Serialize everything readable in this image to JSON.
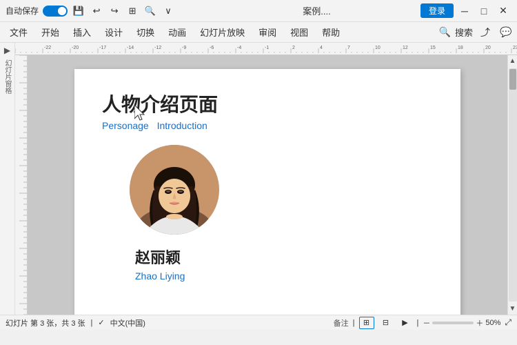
{
  "titlebar": {
    "autosave_label": "自动保存",
    "toggle_state": "on",
    "title": "案例....",
    "login_label": "登录",
    "undo_icon": "↩",
    "redo_icon": "↪",
    "save_icon": "💾",
    "min_icon": "─",
    "max_icon": "□",
    "close_icon": "✕"
  },
  "toolbar": {
    "icons": [
      "💾",
      "↩",
      "↪",
      "⊞",
      "🔍",
      "∨"
    ]
  },
  "menubar": {
    "items": [
      "文件",
      "开始",
      "插入",
      "设计",
      "切换",
      "动画",
      "幻灯片放映",
      "审阅",
      "视图",
      "帮助"
    ],
    "search_placeholder": "搜索"
  },
  "sidebar": {
    "arrow_label": "▶",
    "text_label": "幻灯片窗格"
  },
  "slide": {
    "title_zh": "人物介绍页面",
    "subtitle_personage": "Personage",
    "subtitle_introduction": "Introduction",
    "person_name_zh": "赵丽颖",
    "person_name_en": "Zhao Liying"
  },
  "statusbar": {
    "slide_info": "幻灯片 第 3 张，共 3 张",
    "language": "中文(中国)",
    "notes_label": "备注",
    "zoom_level": "50%",
    "zoom_icon": "+"
  }
}
